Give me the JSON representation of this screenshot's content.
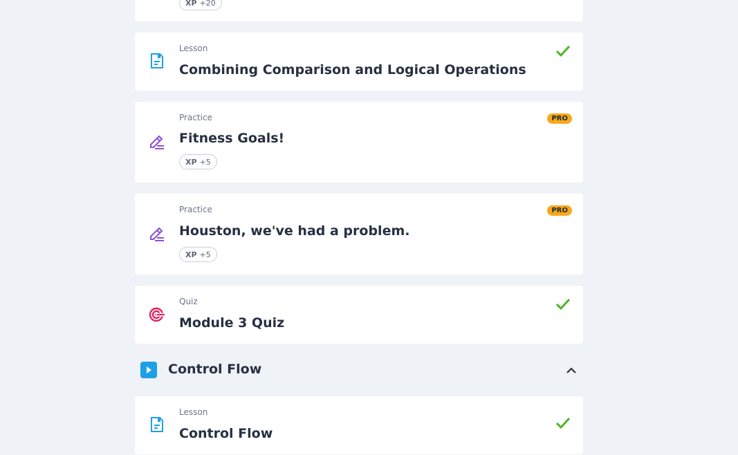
{
  "items": [
    {
      "type": "",
      "title": "",
      "xp_label": "XP",
      "xp_value": "+20"
    },
    {
      "type": "Lesson",
      "title": "Combining Comparison and Logical Operations",
      "completed": true
    },
    {
      "type": "Practice",
      "title": "Fitness Goals!",
      "badge": "PRO",
      "xp_label": "XP",
      "xp_value": "+5"
    },
    {
      "type": "Practice",
      "title": "Houston, we've had a problem.",
      "badge": "PRO",
      "xp_label": "XP",
      "xp_value": "+5"
    },
    {
      "type": "Quiz",
      "title": "Module 3 Quiz",
      "completed": true
    }
  ],
  "section": {
    "title": "Control Flow",
    "expanded": true
  },
  "section_items": [
    {
      "type": "Lesson",
      "title": "Control Flow",
      "completed": true
    }
  ],
  "icons": {
    "lesson": "document-icon",
    "practice": "pencil-icon",
    "quiz": "target-icon",
    "completed": "check-icon",
    "section": "play-icon",
    "collapse": "chevron-up-icon"
  },
  "colors": {
    "background": "#eff2f6",
    "lesson_icon": "#1ea0e6",
    "practice_icon": "#8a4fd8",
    "quiz_icon": "#e0245e",
    "check": "#4cb523",
    "pro_badge": "#f7a81b"
  }
}
